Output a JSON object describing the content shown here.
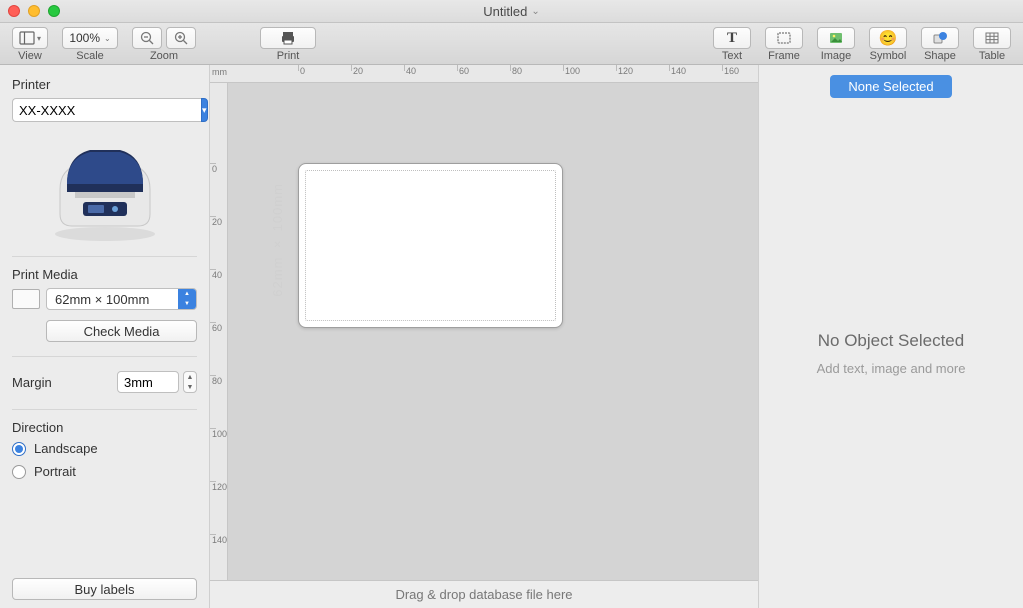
{
  "window": {
    "title": "Untitled"
  },
  "toolbar": {
    "view_label": "View",
    "scale_label": "Scale",
    "scale_value": "100%",
    "zoom_label": "Zoom",
    "print_label": "Print",
    "insert": {
      "text": "Text",
      "frame": "Frame",
      "image": "Image",
      "symbol": "Symbol",
      "shape": "Shape",
      "table": "Table"
    }
  },
  "sidebar": {
    "printer_heading": "Printer",
    "printer_value": "XX-XXXX",
    "print_media_heading": "Print Media",
    "media_value": "62mm × 100mm",
    "check_media_label": "Check Media",
    "margin_heading": "Margin",
    "margin_value": "3mm",
    "direction_heading": "Direction",
    "landscape_label": "Landscape",
    "portrait_label": "Portrait",
    "direction_selected": "landscape",
    "buy_labels_label": "Buy labels"
  },
  "canvas": {
    "ruler_unit": "mm",
    "dimension_label": "62mm × 100mm",
    "drop_hint": "Drag & drop database file here",
    "h_ticks": [
      0,
      20,
      40,
      60,
      80,
      100,
      120,
      140,
      160
    ],
    "v_ticks": [
      0,
      20,
      40,
      60,
      80,
      100,
      120,
      140
    ]
  },
  "inspector": {
    "badge": "None Selected",
    "title": "No Object Selected",
    "subtitle": "Add text, image and more"
  }
}
